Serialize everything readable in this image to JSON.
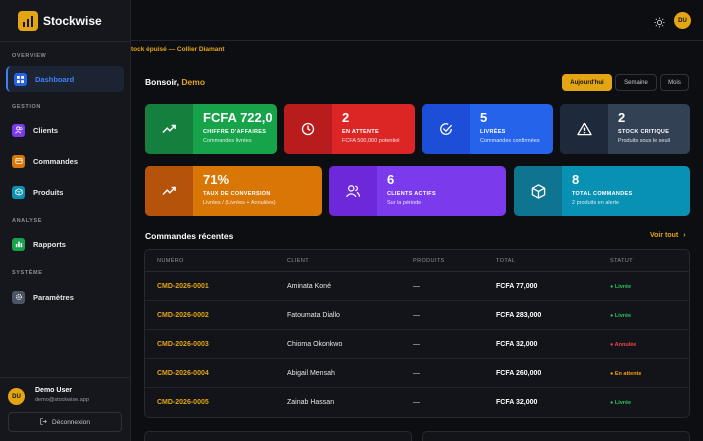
{
  "app": {
    "name": "Stockwise"
  },
  "sidebar": {
    "sections": [
      "OVERVIEW",
      "GESTION",
      "ANALYSE",
      "SYSTÈME"
    ],
    "items": [
      {
        "label": "Dashboard",
        "icon": "grid-icon",
        "color": "#2563eb"
      },
      {
        "label": "Clients",
        "icon": "users-icon",
        "color": "#7c3aed"
      },
      {
        "label": "Commandes",
        "icon": "cart-icon",
        "color": "#d97706"
      },
      {
        "label": "Produits",
        "icon": "box-icon",
        "color": "#0891b2"
      },
      {
        "label": "Rapports",
        "icon": "bar-chart-icon",
        "color": "#16a34a"
      },
      {
        "label": "Paramètres",
        "icon": "gear-icon",
        "color": "#4b5563"
      }
    ]
  },
  "user": {
    "initials": "DU",
    "name": "Demo User",
    "email": "demo@stockwise.app",
    "logout_label": "Déconnexion"
  },
  "topbar": {
    "avatar_initials": "DU"
  },
  "ticker": {
    "text": "tock épuisé — Collier Diamant"
  },
  "greeting": {
    "prefix": "Bonsoir,",
    "name": "Demo"
  },
  "range": {
    "options": [
      "Aujourd'hui",
      "Semaine",
      "Mois"
    ],
    "selected": "Aujourd'hui"
  },
  "stats_row1": [
    {
      "value": "FCFA 722,0",
      "label": "CHIFFRE D'AFFAIRES",
      "sub": "Commandes livrées",
      "color": "#16a34a",
      "icon_bg": "#15803d",
      "icon": "trend-up-icon"
    },
    {
      "value": "2",
      "label": "EN ATTENTE",
      "sub": "FCFA 500,000 potentiel",
      "color": "#dc2626",
      "icon_bg": "#b91c1c",
      "icon": "clock-icon"
    },
    {
      "value": "5",
      "label": "LIVRÉES",
      "sub": "Commandes confirmées",
      "color": "#2563eb",
      "icon_bg": "#1d4ed8",
      "icon": "check-circle-icon"
    },
    {
      "value": "2",
      "label": "STOCK CRITIQUE",
      "sub": "Produits sous le seuil",
      "color": "#334155",
      "icon_bg": "#1e293b",
      "icon": "warning-icon"
    }
  ],
  "stats_row2": [
    {
      "value": "71%",
      "label": "TAUX DE CONVERSION",
      "sub": "Livrées / (Livrées + Annulées)",
      "color": "#d97706",
      "icon_bg": "#b45309",
      "icon": "trend-up-icon"
    },
    {
      "value": "6",
      "label": "CLIENTS ACTIFS",
      "sub": "Sur la période",
      "color": "#7c3aed",
      "icon_bg": "#6d28d9",
      "icon": "users-icon"
    },
    {
      "value": "8",
      "label": "TOTAL COMMANDES",
      "sub": "2 produits en alerte",
      "color": "#0891b2",
      "icon_bg": "#0e7490",
      "icon": "cube-icon"
    }
  ],
  "orders": {
    "title": "Commandes récentes",
    "see_all": "Voir tout",
    "columns": [
      "NUMÉRO",
      "CLIENT",
      "PRODUITS",
      "TOTAL",
      "STATUT"
    ],
    "rows": [
      {
        "id": "CMD-2026-0001",
        "client": "Aminata Koné",
        "products": "—",
        "total": "FCFA 77,000",
        "status": "Livrée",
        "status_color": "#22c55e"
      },
      {
        "id": "CMD-2026-0002",
        "client": "Fatoumata Diallo",
        "products": "—",
        "total": "FCFA 283,000",
        "status": "Livrée",
        "status_color": "#22c55e"
      },
      {
        "id": "CMD-2026-0003",
        "client": "Chioma Okonkwo",
        "products": "—",
        "total": "FCFA 32,000",
        "status": "Annulée",
        "status_color": "#ef4444"
      },
      {
        "id": "CMD-2026-0004",
        "client": "Abigail Mensah",
        "products": "—",
        "total": "FCFA 260,000",
        "status": "En attente",
        "status_color": "#f59e0b"
      },
      {
        "id": "CMD-2026-0005",
        "client": "Zainab Hassan",
        "products": "—",
        "total": "FCFA 32,000",
        "status": "Livrée",
        "status_color": "#22c55e"
      }
    ]
  }
}
